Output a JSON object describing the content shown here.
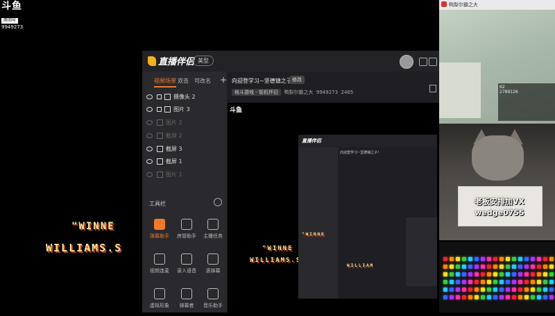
{
  "stream_logo": {
    "brand": "斗鱼",
    "sub": "房间号",
    "room_number": "9949273"
  },
  "game_text": {
    "line1": "\"WINNE",
    "line2": "WILLIAMS.S"
  },
  "app": {
    "brand": "直播伴侣",
    "mode_button": "美型",
    "scene_tabs": [
      "视频场景",
      "双击",
      "可改名"
    ],
    "add_scene": "+",
    "sources": [
      {
        "label": "摄像头 2",
        "dim": false
      },
      {
        "label": "图片 3",
        "dim": false
      },
      {
        "label": "图片 2",
        "dim": true
      },
      {
        "label": "截屏 2",
        "dim": true
      },
      {
        "label": "截屏 3",
        "dim": false
      },
      {
        "label": "截屏 1",
        "dim": false
      },
      {
        "label": "图片 1",
        "dim": true
      }
    ],
    "tools_header": "工具栏",
    "tools": [
      "弹幕助手",
      "房管助手",
      "主播任务",
      "视频连麦",
      "录入语音",
      "滚弹幕",
      "虚拟形象",
      "弹幕者",
      "音乐助手"
    ],
    "room_title": "向迎登学习~坚德镇之子!",
    "edit_label": "修改",
    "room_category": "格斗游戏 - 街机怀旧",
    "room_owner": "鸭梨尔霸之大",
    "room_id": "9949273",
    "fans": "2465"
  },
  "mini_stream": {
    "name": "鸭梨尔霸之大",
    "level": "62",
    "uid": "2789126"
  },
  "cat_sign": {
    "line1": "老板安排加VX",
    "line2": "wedge0755"
  },
  "colors": {
    "accent": "#f07a2a",
    "brand_yellow": "#f5b11b",
    "retro_text": "#f7e39a"
  }
}
